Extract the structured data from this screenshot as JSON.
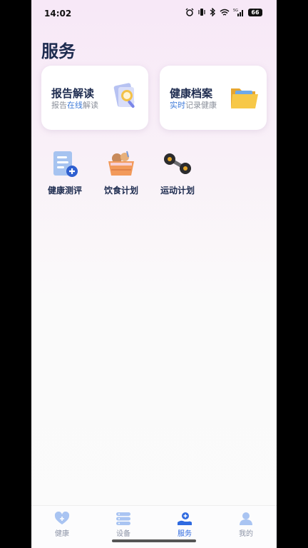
{
  "status_bar": {
    "time": "14:02",
    "battery": "66"
  },
  "page": {
    "title": "服务"
  },
  "cards": [
    {
      "title": "报告解读",
      "sub_pre": "报告",
      "sub_hl": "在线",
      "sub_post": "解读",
      "icon": "report-search-icon"
    },
    {
      "title": "健康档案",
      "sub_pre": "",
      "sub_hl": "实时",
      "sub_post": "记录健康",
      "icon": "folder-icon"
    }
  ],
  "services": [
    {
      "label": "健康测评",
      "icon": "health-assessment-icon"
    },
    {
      "label": "饮食计划",
      "icon": "food-basket-icon"
    },
    {
      "label": "运动计划",
      "icon": "dumbbell-icon"
    }
  ],
  "tabs": [
    {
      "label": "健康",
      "icon": "heart-icon",
      "active": false
    },
    {
      "label": "设备",
      "icon": "device-icon",
      "active": false
    },
    {
      "label": "服务",
      "icon": "service-hand-icon",
      "active": true
    },
    {
      "label": "我的",
      "icon": "user-icon",
      "active": false
    }
  ],
  "colors": {
    "accent": "#2f6ae0",
    "title": "#1d2b4f",
    "highlight": "#3f7bd9"
  }
}
